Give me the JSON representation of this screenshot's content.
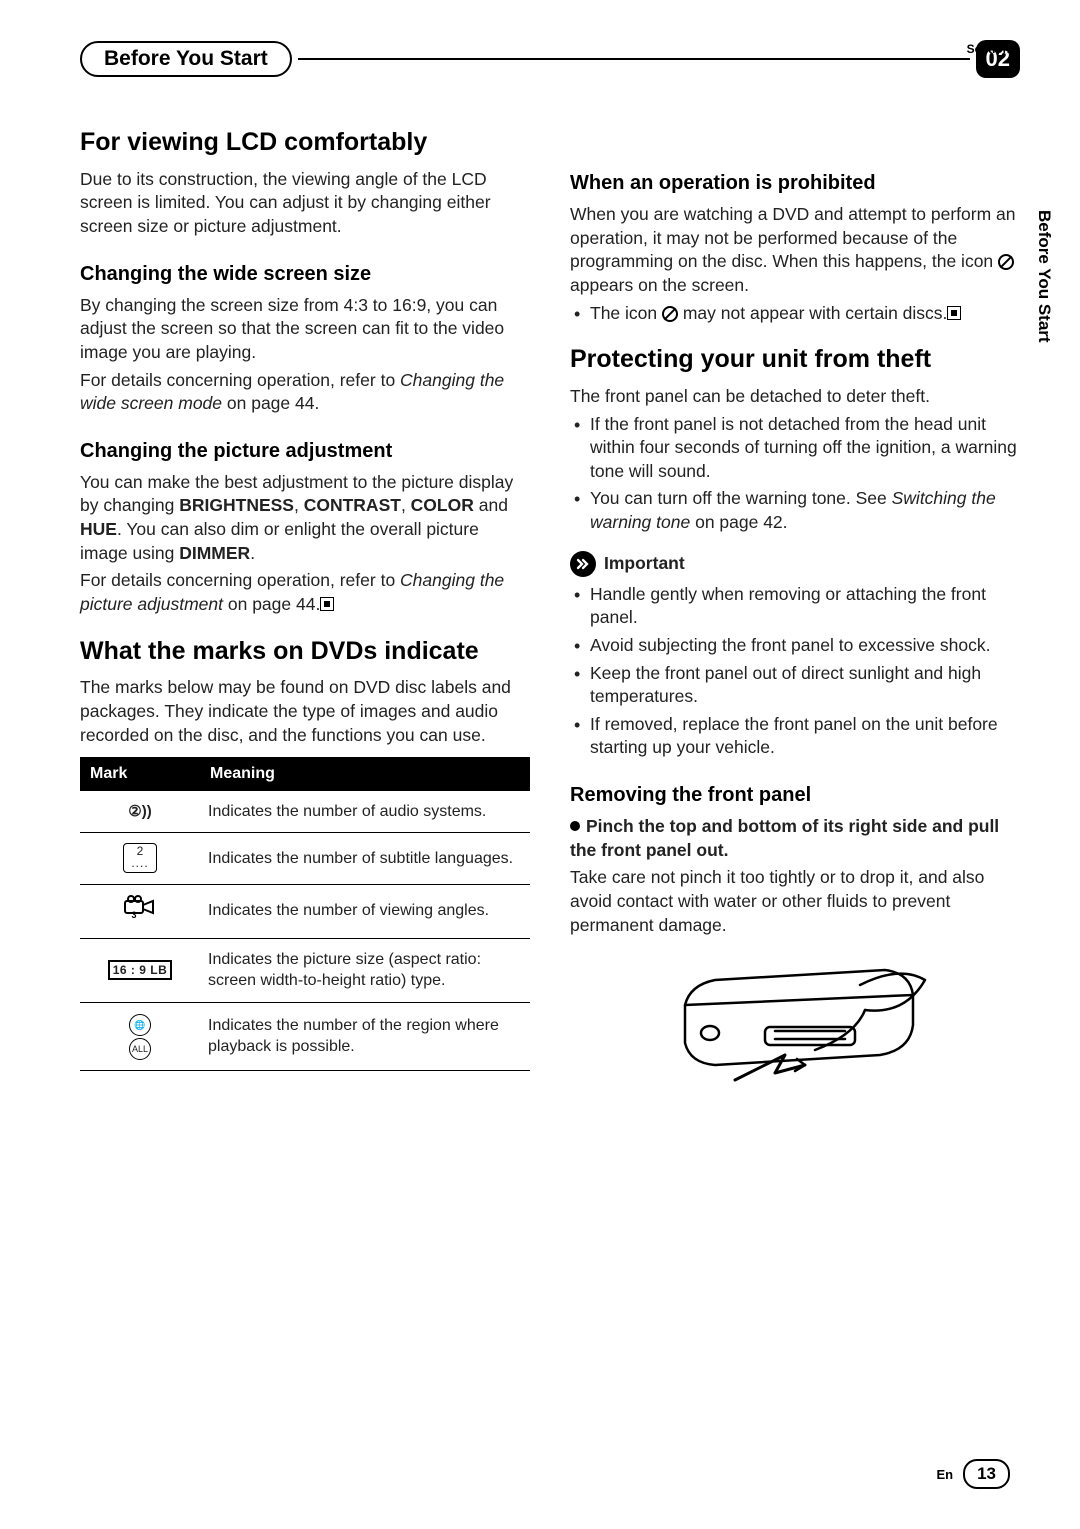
{
  "header": {
    "tab_title": "Before You Start",
    "section_label": "Section",
    "section_number": "02",
    "vertical_tab": "Before You Start"
  },
  "left": {
    "h1_lcd": "For viewing LCD comfortably",
    "p_lcd": "Due to its construction, the viewing angle of the LCD screen is limited. You can adjust it by changing either screen size or picture adjustment.",
    "h2_wide": "Changing the wide screen size",
    "p_wide_1": "By changing the screen size from 4:3 to 16:9, you can adjust the screen so that the screen can fit to the video image you are playing.",
    "p_wide_2a": "For details concerning operation, refer to ",
    "p_wide_2_em": "Changing the wide screen mode",
    "p_wide_2b": " on page 44.",
    "h2_pic": "Changing the picture adjustment",
    "p_pic_1a": "You can make the best adjustment to the picture display by changing ",
    "p_pic_1_bright": "BRIGHTNESS",
    "p_pic_1_sep1": ", ",
    "p_pic_1_contrast": "CONTRAST",
    "p_pic_1_sep2": ", ",
    "p_pic_1_color": "COLOR",
    "p_pic_1_and": " and ",
    "p_pic_1_hue": "HUE",
    "p_pic_1b": ". You can also dim or enlight the overall picture image using ",
    "p_pic_1_dimmer": "DIMMER",
    "p_pic_1_period": ".",
    "p_pic_2a": "For details concerning operation, refer to ",
    "p_pic_2_em": "Changing the picture adjustment",
    "p_pic_2b": " on page 44.",
    "h1_marks": "What the marks on DVDs indicate",
    "p_marks": "The marks below may be found on DVD disc labels and packages. They indicate the type of images and audio recorded on the disc, and the functions you can use.",
    "table": {
      "col_mark": "Mark",
      "col_meaning": "Meaning",
      "rows": [
        {
          "meaning": "Indicates the number of audio systems."
        },
        {
          "meaning": "Indicates the number of subtitle languages."
        },
        {
          "meaning": "Indicates the number of viewing angles."
        },
        {
          "meaning": "Indicates the picture size (aspect ratio: screen width-to-height ratio) type."
        },
        {
          "meaning": "Indicates the number of the region where playback is possible."
        }
      ],
      "ratio_label": "16 : 9  LB",
      "subtitle_num": "2",
      "angle_num": "3",
      "region_all": "ALL"
    }
  },
  "right": {
    "h2_prohibited": "When an operation is prohibited",
    "p_prohibited_a": "When you are watching a DVD and attempt to perform an operation, it may not be performed because of the programming on the disc. When this happens, the icon ",
    "p_prohibited_b": " appears on the screen.",
    "li_prohibited_a": "The icon ",
    "li_prohibited_b": " may not appear with certain discs.",
    "h1_theft": "Protecting your unit from theft",
    "p_theft": "The front panel can be detached to deter theft.",
    "li_theft_1": "If the front panel is not detached from the head unit within four seconds of turning off the ignition, a warning tone will sound.",
    "li_theft_2a": "You can turn off the warning tone. See ",
    "li_theft_2_em": "Switching the warning tone",
    "li_theft_2b": " on page 42.",
    "important_label": "Important",
    "li_imp_1": "Handle gently when removing or attaching the front panel.",
    "li_imp_2": "Avoid subjecting the front panel to excessive shock.",
    "li_imp_3": "Keep the front panel out of direct sunlight and high temperatures.",
    "li_imp_4": "If removed, replace the front panel on the unit before starting up your vehicle.",
    "h2_removing": "Removing the front panel",
    "step_1": "Pinch the top and bottom of its right side and pull the front panel out.",
    "p_removing": "Take care not pinch it too tightly or to drop it, and also avoid contact with water or other fluids to prevent permanent damage."
  },
  "footer": {
    "lang": "En",
    "page": "13"
  }
}
